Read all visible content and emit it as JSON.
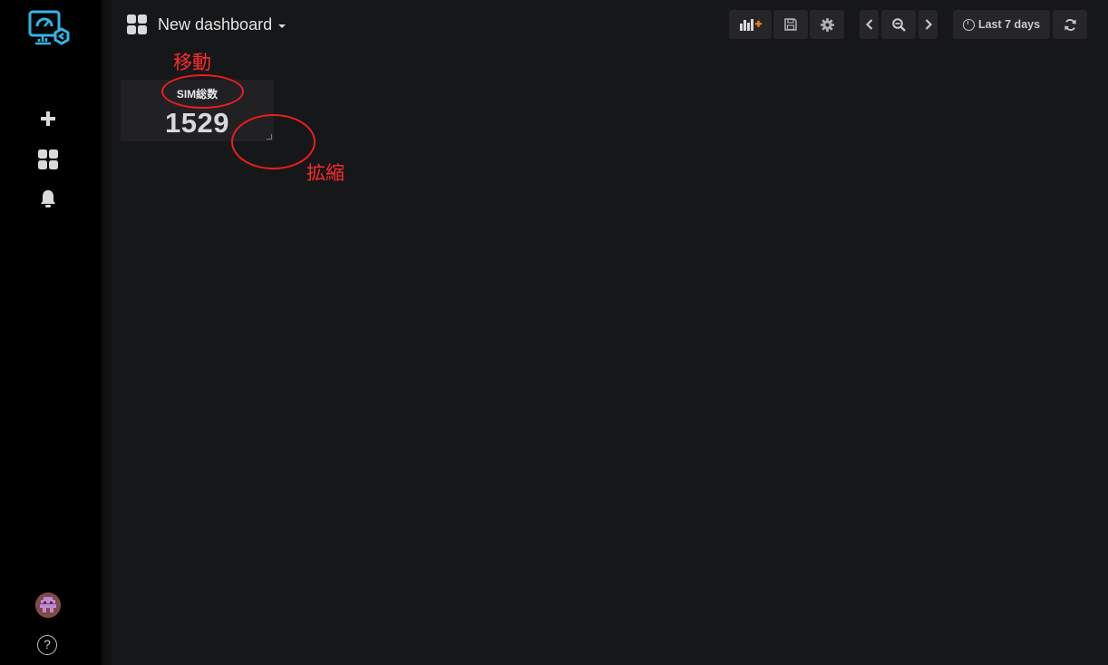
{
  "header": {
    "dashboard_title": "New dashboard",
    "time_range_label": "Last 7 days"
  },
  "toolbar": {
    "icons": [
      "add-panel-icon",
      "save-icon",
      "settings-icon",
      "chevron-left-icon",
      "zoom-out-icon",
      "chevron-right-icon",
      "clock-icon",
      "refresh-icon"
    ]
  },
  "sidebar": {
    "items": [
      "create-icon",
      "dashboards-icon",
      "alerting-icon"
    ],
    "help_label": "?"
  },
  "panel": {
    "title": "SIM総数",
    "value": "1529"
  },
  "annotations": {
    "move_label": "移動",
    "resize_label": "拡縮"
  },
  "colors": {
    "background": "#161719",
    "sidebar": "#000000",
    "panel": "#212124",
    "button": "#262628",
    "accent_logo": "#33b5e5",
    "annotation": "#ff2b2b",
    "add_panel_orange": "#eb7b18"
  }
}
